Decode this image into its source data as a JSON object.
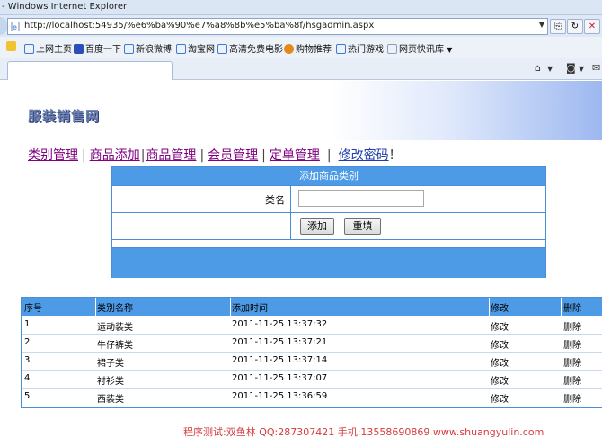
{
  "window": {
    "title": "- Windows Internet Explorer"
  },
  "address": {
    "url": "http://localhost:54935/%e6%ba%90%e7%a8%8b%e5%ba%8f/hsgadmin.aspx"
  },
  "favorites": [
    {
      "label": "上网主页",
      "color": "#3a7bd5"
    },
    {
      "label": "百度一下",
      "color": "#2b4fb6"
    },
    {
      "label": "新浪微博",
      "color": "#3a7bd5"
    },
    {
      "label": "淘宝网",
      "color": "#3a7bd5"
    },
    {
      "label": "高清免费电影",
      "color": "#3a7bd5"
    },
    {
      "label": "购物推荐",
      "color": "#e08a1e"
    },
    {
      "label": "热门游戏",
      "color": "#3a7bd5"
    },
    {
      "label": "网页快讯库",
      "color": "#8aa0c0"
    }
  ],
  "page": {
    "logo": "服装销售网",
    "nav": [
      "类别管理",
      "商品添加",
      "商品管理",
      "会员管理",
      "定单管理",
      "修改密码"
    ],
    "nav_suffix": "！"
  },
  "form": {
    "title": "添加商品类别",
    "field_label": "类名",
    "field_value": "",
    "add_button": "添加",
    "reset_button": "重填"
  },
  "table": {
    "headers": [
      "序号",
      "类别名称",
      "添加时间",
      "修改",
      "删除"
    ],
    "rows": [
      [
        "1",
        "运动装类",
        "2011-11-25 13:37:32",
        "修改",
        "删除"
      ],
      [
        "2",
        "牛仔裤类",
        "2011-11-25 13:37:21",
        "修改",
        "删除"
      ],
      [
        "3",
        "裙子类",
        "2011-11-25 13:37:14",
        "修改",
        "删除"
      ],
      [
        "4",
        "衬衫类",
        "2011-11-25 13:37:07",
        "修改",
        "删除"
      ],
      [
        "5",
        "西装类",
        "2011-11-25 13:36:59",
        "修改",
        "删除"
      ]
    ]
  },
  "footer": "程序测试:双鱼林 QQ:287307421 手机:13558690869 www.shuangyulin.com",
  "colors": {
    "accent": "#4d9be6",
    "nav_visited": "#800080",
    "nav_link": "#1f3fa8",
    "footer": "#d43c3c"
  }
}
